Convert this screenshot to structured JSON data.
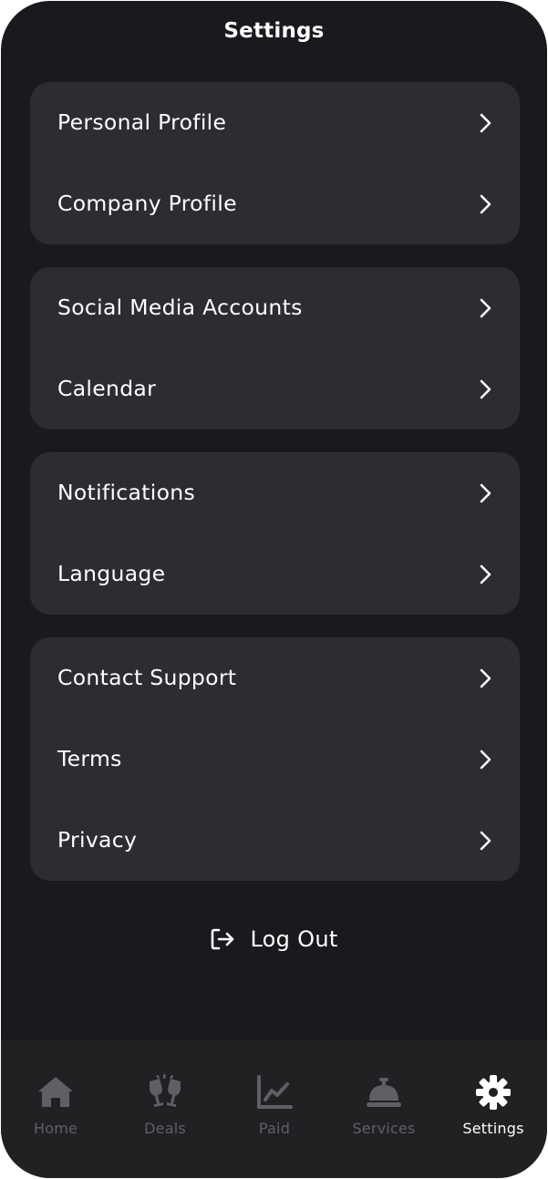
{
  "header": {
    "title": "Settings"
  },
  "groups": [
    {
      "items": [
        {
          "label": "Personal Profile"
        },
        {
          "label": "Company Profile"
        }
      ]
    },
    {
      "items": [
        {
          "label": "Social Media Accounts"
        },
        {
          "label": "Calendar"
        }
      ]
    },
    {
      "items": [
        {
          "label": "Notifications"
        },
        {
          "label": "Language"
        }
      ]
    },
    {
      "items": [
        {
          "label": "Contact Support"
        },
        {
          "label": "Terms"
        },
        {
          "label": "Privacy"
        }
      ]
    }
  ],
  "logout": {
    "label": "Log Out",
    "icon": "logout-icon"
  },
  "tabbar": {
    "active": "Settings",
    "tabs": [
      {
        "label": "Home",
        "icon": "home-icon"
      },
      {
        "label": "Deals",
        "icon": "champagne-glasses-icon"
      },
      {
        "label": "Paid",
        "icon": "line-chart-icon"
      },
      {
        "label": "Services",
        "icon": "service-bell-icon"
      },
      {
        "label": "Settings",
        "icon": "gear-icon"
      }
    ]
  },
  "colors": {
    "background": "#1a1a1e",
    "card": "#2c2c33",
    "tabbar": "#212124",
    "text": "#ffffff",
    "inactive_tab": "#5f5f66"
  }
}
